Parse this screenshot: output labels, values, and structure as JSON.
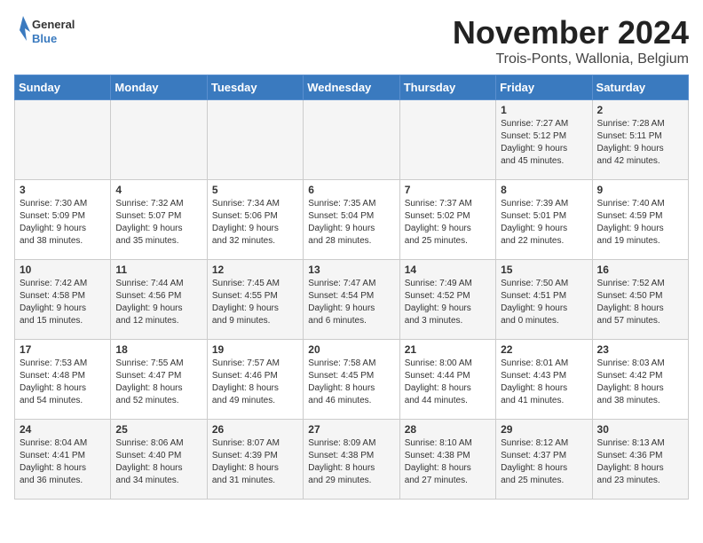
{
  "header": {
    "logo_general": "General",
    "logo_blue": "Blue",
    "month": "November 2024",
    "location": "Trois-Ponts, Wallonia, Belgium"
  },
  "days_of_week": [
    "Sunday",
    "Monday",
    "Tuesday",
    "Wednesday",
    "Thursday",
    "Friday",
    "Saturday"
  ],
  "weeks": [
    [
      {
        "day": "",
        "info": ""
      },
      {
        "day": "",
        "info": ""
      },
      {
        "day": "",
        "info": ""
      },
      {
        "day": "",
        "info": ""
      },
      {
        "day": "",
        "info": ""
      },
      {
        "day": "1",
        "info": "Sunrise: 7:27 AM\nSunset: 5:12 PM\nDaylight: 9 hours\nand 45 minutes."
      },
      {
        "day": "2",
        "info": "Sunrise: 7:28 AM\nSunset: 5:11 PM\nDaylight: 9 hours\nand 42 minutes."
      }
    ],
    [
      {
        "day": "3",
        "info": "Sunrise: 7:30 AM\nSunset: 5:09 PM\nDaylight: 9 hours\nand 38 minutes."
      },
      {
        "day": "4",
        "info": "Sunrise: 7:32 AM\nSunset: 5:07 PM\nDaylight: 9 hours\nand 35 minutes."
      },
      {
        "day": "5",
        "info": "Sunrise: 7:34 AM\nSunset: 5:06 PM\nDaylight: 9 hours\nand 32 minutes."
      },
      {
        "day": "6",
        "info": "Sunrise: 7:35 AM\nSunset: 5:04 PM\nDaylight: 9 hours\nand 28 minutes."
      },
      {
        "day": "7",
        "info": "Sunrise: 7:37 AM\nSunset: 5:02 PM\nDaylight: 9 hours\nand 25 minutes."
      },
      {
        "day": "8",
        "info": "Sunrise: 7:39 AM\nSunset: 5:01 PM\nDaylight: 9 hours\nand 22 minutes."
      },
      {
        "day": "9",
        "info": "Sunrise: 7:40 AM\nSunset: 4:59 PM\nDaylight: 9 hours\nand 19 minutes."
      }
    ],
    [
      {
        "day": "10",
        "info": "Sunrise: 7:42 AM\nSunset: 4:58 PM\nDaylight: 9 hours\nand 15 minutes."
      },
      {
        "day": "11",
        "info": "Sunrise: 7:44 AM\nSunset: 4:56 PM\nDaylight: 9 hours\nand 12 minutes."
      },
      {
        "day": "12",
        "info": "Sunrise: 7:45 AM\nSunset: 4:55 PM\nDaylight: 9 hours\nand 9 minutes."
      },
      {
        "day": "13",
        "info": "Sunrise: 7:47 AM\nSunset: 4:54 PM\nDaylight: 9 hours\nand 6 minutes."
      },
      {
        "day": "14",
        "info": "Sunrise: 7:49 AM\nSunset: 4:52 PM\nDaylight: 9 hours\nand 3 minutes."
      },
      {
        "day": "15",
        "info": "Sunrise: 7:50 AM\nSunset: 4:51 PM\nDaylight: 9 hours\nand 0 minutes."
      },
      {
        "day": "16",
        "info": "Sunrise: 7:52 AM\nSunset: 4:50 PM\nDaylight: 8 hours\nand 57 minutes."
      }
    ],
    [
      {
        "day": "17",
        "info": "Sunrise: 7:53 AM\nSunset: 4:48 PM\nDaylight: 8 hours\nand 54 minutes."
      },
      {
        "day": "18",
        "info": "Sunrise: 7:55 AM\nSunset: 4:47 PM\nDaylight: 8 hours\nand 52 minutes."
      },
      {
        "day": "19",
        "info": "Sunrise: 7:57 AM\nSunset: 4:46 PM\nDaylight: 8 hours\nand 49 minutes."
      },
      {
        "day": "20",
        "info": "Sunrise: 7:58 AM\nSunset: 4:45 PM\nDaylight: 8 hours\nand 46 minutes."
      },
      {
        "day": "21",
        "info": "Sunrise: 8:00 AM\nSunset: 4:44 PM\nDaylight: 8 hours\nand 44 minutes."
      },
      {
        "day": "22",
        "info": "Sunrise: 8:01 AM\nSunset: 4:43 PM\nDaylight: 8 hours\nand 41 minutes."
      },
      {
        "day": "23",
        "info": "Sunrise: 8:03 AM\nSunset: 4:42 PM\nDaylight: 8 hours\nand 38 minutes."
      }
    ],
    [
      {
        "day": "24",
        "info": "Sunrise: 8:04 AM\nSunset: 4:41 PM\nDaylight: 8 hours\nand 36 minutes."
      },
      {
        "day": "25",
        "info": "Sunrise: 8:06 AM\nSunset: 4:40 PM\nDaylight: 8 hours\nand 34 minutes."
      },
      {
        "day": "26",
        "info": "Sunrise: 8:07 AM\nSunset: 4:39 PM\nDaylight: 8 hours\nand 31 minutes."
      },
      {
        "day": "27",
        "info": "Sunrise: 8:09 AM\nSunset: 4:38 PM\nDaylight: 8 hours\nand 29 minutes."
      },
      {
        "day": "28",
        "info": "Sunrise: 8:10 AM\nSunset: 4:38 PM\nDaylight: 8 hours\nand 27 minutes."
      },
      {
        "day": "29",
        "info": "Sunrise: 8:12 AM\nSunset: 4:37 PM\nDaylight: 8 hours\nand 25 minutes."
      },
      {
        "day": "30",
        "info": "Sunrise: 8:13 AM\nSunset: 4:36 PM\nDaylight: 8 hours\nand 23 minutes."
      }
    ]
  ]
}
